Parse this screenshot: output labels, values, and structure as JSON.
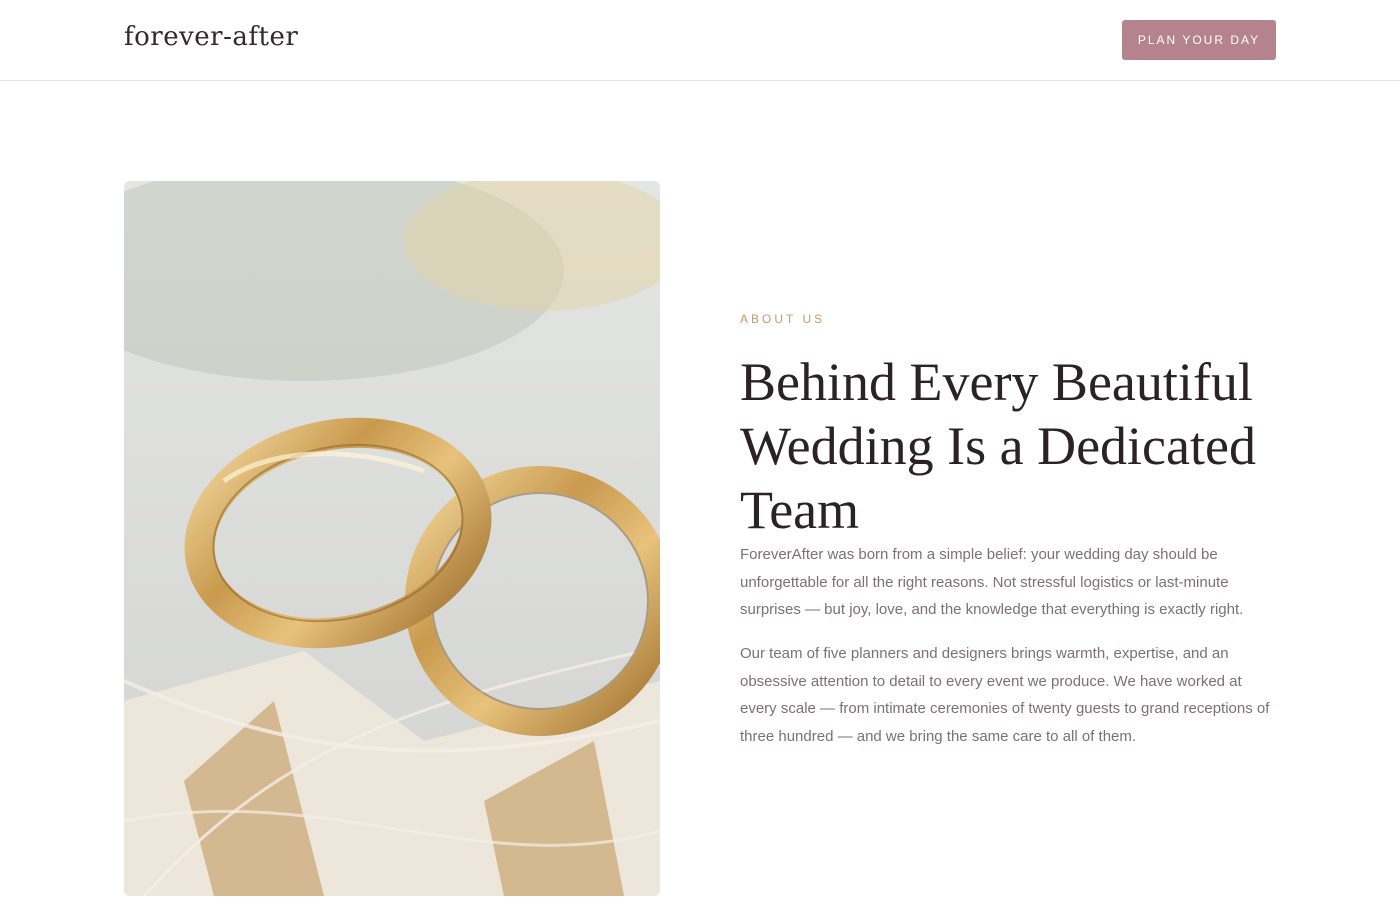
{
  "header": {
    "logo": "forever-after",
    "cta_label": "PLAN YOUR DAY"
  },
  "about": {
    "eyebrow": "ABOUT US",
    "headline": "Behind Every Beautiful Wedding Is a Dedicated Team",
    "paragraphs": [
      "ForeverAfter was born from a simple belief: your wedding day should be unforgettable for all the right reasons. Not stressful logistics or last-minute surprises — but joy, love, and the knowledge that everything is exactly right.",
      "Our team of five planners and designers brings warmth, expertise, and an obsessive attention to detail to every event we produce. We have worked at every scale — from intimate ceremonies of twenty guests to grand receptions of three hundred — and we bring the same care to all of them."
    ]
  },
  "colors": {
    "accent": "#b5838d",
    "eyebrow": "#c49a6c",
    "heading": "#2a2224",
    "body_text": "#7e6f72"
  },
  "image": {
    "subject": "wedding-rings-photo"
  }
}
